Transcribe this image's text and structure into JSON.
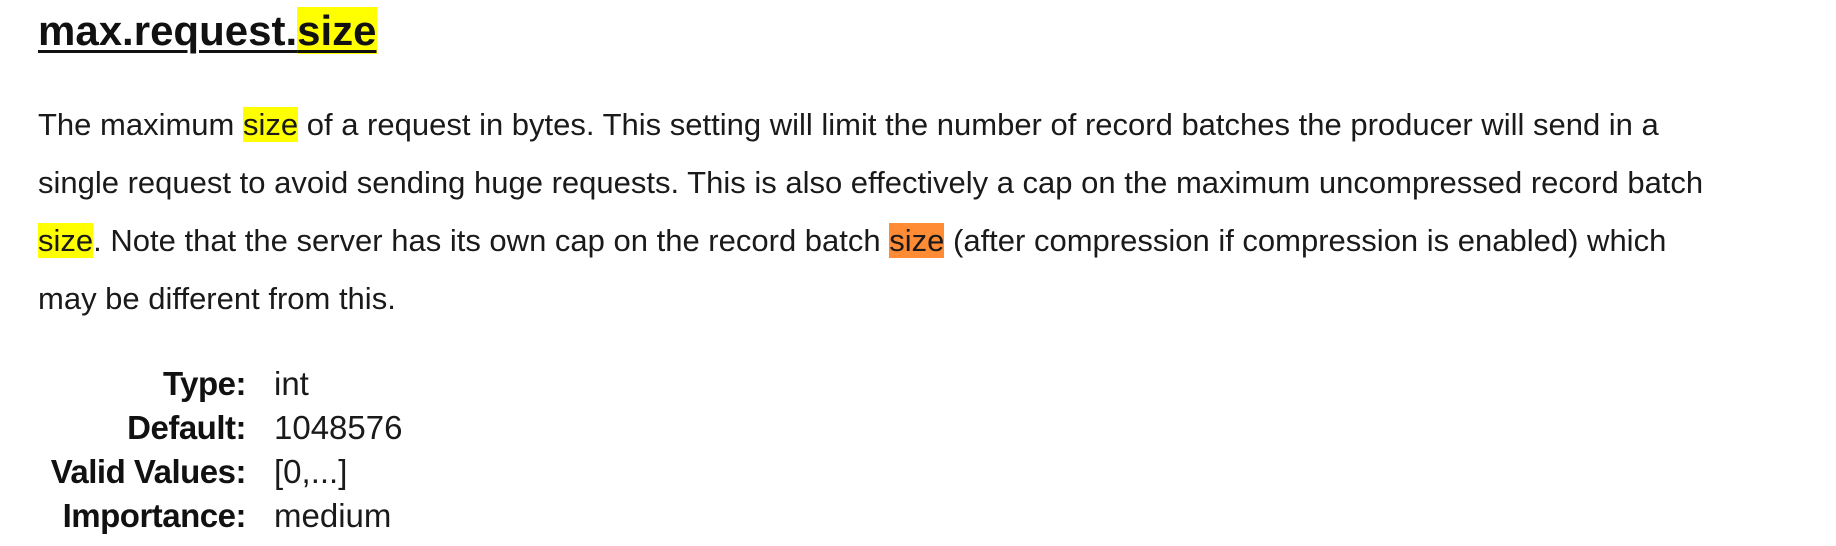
{
  "title": {
    "prefix": "max.request.",
    "highlight": "size",
    "highlight_color": "#ffff00"
  },
  "description": {
    "line1": {
      "pre": "The maximum ",
      "hl": "size",
      "post": " of a request in bytes. This setting will limit the number of record batches the producer will send in a"
    },
    "line2": "single request to avoid sending huge requests. This is also effectively a cap on the maximum uncompressed record batch",
    "line3": {
      "hl1": "size",
      "mid": ". Note that the server has its own cap on the record batch ",
      "hl2_current": "size",
      "post": " (after compression if compression is enabled) which"
    },
    "line4": "may be different from this.",
    "highlight_color": "#ffff00",
    "current_match_color": "#ff8c35"
  },
  "properties": [
    {
      "key": "Type:",
      "value": "int"
    },
    {
      "key": "Default:",
      "value": "1048576"
    },
    {
      "key": "Valid Values:",
      "value": "[0,...]"
    },
    {
      "key": "Importance:",
      "value": "medium"
    }
  ]
}
